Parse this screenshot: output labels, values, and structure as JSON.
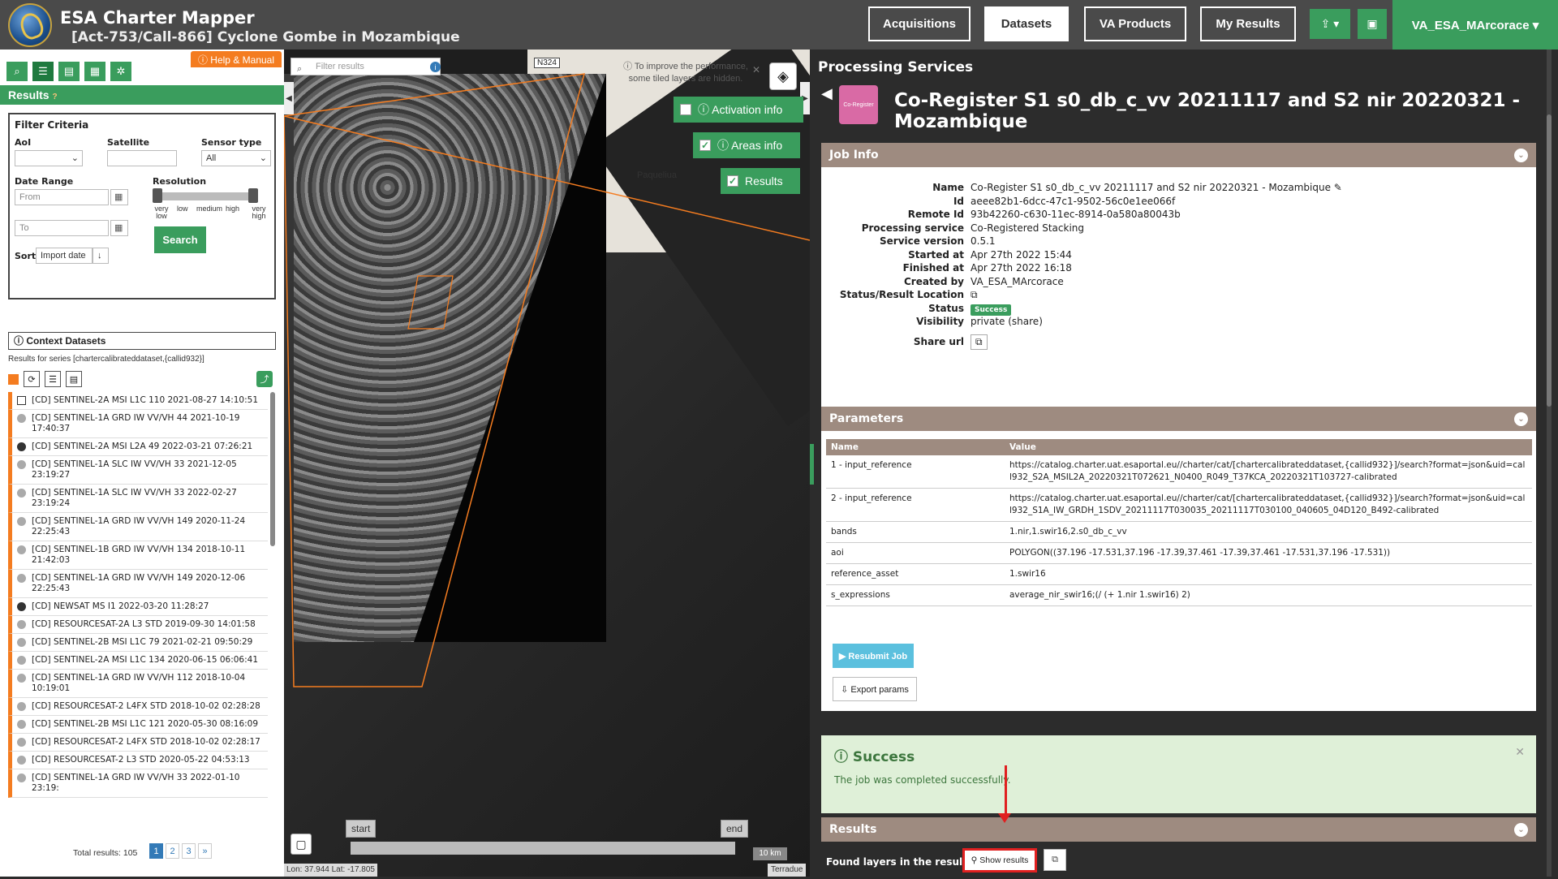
{
  "header": {
    "app_title": "ESA Charter Mapper",
    "activation": "[Act-753/Call-866] Cyclone Gombe in Mozambique",
    "nav": [
      "Acquisitions",
      "Datasets",
      "VA Products",
      "My Results"
    ],
    "active_nav": "Datasets",
    "user": "VA_ESA_MArcorace ▾",
    "upload_icon": "upload-icon",
    "briefcase_icon": "briefcase-icon"
  },
  "left": {
    "help": "ⓘ Help & Manual",
    "results_title": "Results",
    "filter": {
      "title": "Filter Criteria",
      "aoi_label": "AoI",
      "satellite_label": "Satellite",
      "sensor_label": "Sensor type",
      "sensor_value": "All",
      "date_label": "Date Range",
      "from_placeholder": "From",
      "to_placeholder": "To",
      "resolution_label": "Resolution",
      "res_ticks": [
        "very low",
        "low",
        "medium",
        "high",
        "very high"
      ],
      "sort_label": "Sort",
      "sort_value": "Import date",
      "search": "Search"
    },
    "context_title": "Context Datasets",
    "series_label": "Results for series [chartercalibrateddataset,{callid932}]",
    "datasets": [
      "[CD] SENTINEL-2A MSI L1C 110 2021-08-27 14:10:51",
      "[CD] SENTINEL-1A GRD IW VV/VH 44 2021-10-19 17:40:37",
      "[CD] SENTINEL-2A MSI L2A 49 2022-03-21 07:26:21",
      "[CD] SENTINEL-1A SLC IW VV/VH 33 2021-12-05 23:19:27",
      "[CD] SENTINEL-1A SLC IW VV/VH 33 2022-02-27 23:19:24",
      "[CD] SENTINEL-1A GRD IW VV/VH 149 2020-11-24 22:25:43",
      "[CD] SENTINEL-1B GRD IW VV/VH 134 2018-10-11 21:42:03",
      "[CD] SENTINEL-1A GRD IW VV/VH 149 2020-12-06 22:25:43",
      "[CD] NEWSAT MS I1 2022-03-20 11:28:27",
      "[CD] RESOURCESAT-2A L3 STD 2019-09-30 14:01:58",
      "[CD] SENTINEL-2B MSI L1C 79 2021-02-21 09:50:29",
      "[CD] SENTINEL-2A MSI L1C 134 2020-06-15 06:06:41",
      "[CD] SENTINEL-1A GRD IW VV/VH 112 2018-10-04 10:19:01",
      "[CD] RESOURCESAT-2 L4FX STD 2018-10-02 02:28:28",
      "[CD] SENTINEL-2B MSI L1C 121 2020-05-30 08:16:09",
      "[CD] RESOURCESAT-2 L4FX STD 2018-10-02 02:28:17",
      "[CD] RESOURCESAT-2 L3 STD 2020-05-22 04:53:13",
      "[CD] SENTINEL-1A GRD IW VV/VH 33 2022-01-10 23:19:"
    ],
    "total_results": "Total results: 105",
    "pages": [
      "1",
      "2",
      "3",
      "»"
    ]
  },
  "map": {
    "filter_placeholder": "Filter results",
    "perf_note": "ⓘ To improve the performance, some tiled layers are hidden.",
    "activation_info": "ⓘ Activation info",
    "areas_info": "ⓘ Areas info",
    "results_btn": "Results",
    "road": "N324",
    "place": "Paqueliua",
    "timeline_start": "start",
    "timeline_end": "end",
    "scale": "10 km",
    "coords": "Lon: 37.944 Lat: -17.805",
    "attribution": "Terradue"
  },
  "right": {
    "section_title": "Processing Services",
    "job_title": "Co-Register S1 s0_db_c_vv 20211117 and S2 nir 20220321 - Mozambique",
    "svc_icon_label": "Co-Register",
    "job_info_title": "Job Info",
    "job_info": [
      {
        "k": "Name",
        "v": "Co-Register S1 s0_db_c_vv 20211117 and S2 nir 20220321 - Mozambique ✎"
      },
      {
        "k": "Id",
        "v": "aeee82b1-6dcc-47c1-9502-56c0e1ee066f"
      },
      {
        "k": "Remote Id",
        "v": "93b42260-c630-11ec-8914-0a580a80043b"
      },
      {
        "k": "Processing service",
        "v": "Co-Registered Stacking"
      },
      {
        "k": "Service version",
        "v": "0.5.1"
      },
      {
        "k": "Started at",
        "v": "Apr 27th 2022 15:44"
      },
      {
        "k": "Finished at",
        "v": "Apr 27th 2022 16:18"
      },
      {
        "k": "Created by",
        "v": "VA_ESA_MArcorace"
      },
      {
        "k": "Status/Result Location",
        "v": "⧉"
      },
      {
        "k": "Status",
        "v": "Success"
      },
      {
        "k": "Visibility",
        "v": "private (share)"
      },
      {
        "k": "Share url",
        "v": "⧉"
      }
    ],
    "params_title": "Parameters",
    "params_headers": [
      "Name",
      "Value"
    ],
    "params": [
      {
        "name": "1 - input_reference",
        "value": "https://catalog.charter.uat.esaportal.eu//charter/cat/[chartercalibrateddataset,{callid932}]/search?format=json&uid=call932_S2A_MSIL2A_20220321T072621_N0400_R049_T37KCA_20220321T103727-calibrated"
      },
      {
        "name": "2 - input_reference",
        "value": "https://catalog.charter.uat.esaportal.eu//charter/cat/[chartercalibrateddataset,{callid932}]/search?format=json&uid=call932_S1A_IW_GRDH_1SDV_20211117T030035_20211117T030100_040605_04D120_B492-calibrated"
      },
      {
        "name": "bands",
        "value": "1.nir,1.swir16,2.s0_db_c_vv"
      },
      {
        "name": "aoi",
        "value": "POLYGON((37.196 -17.531,37.196 -17.39,37.461 -17.39,37.461 -17.531,37.196 -17.531))"
      },
      {
        "name": "reference_asset",
        "value": "1.swir16"
      },
      {
        "name": "s_expressions",
        "value": "average_nir_swir16;(/ (+ 1.nir 1.swir16) 2)"
      }
    ],
    "resubmit": "▶ Resubmit Job",
    "export": "⇩ Export params",
    "success_title": "ⓘ Success",
    "success_msg": "The job was completed successfully.",
    "results_title": "Results",
    "found_label": "Found layers in the result.",
    "show_results": "⚲ Show results",
    "copy_icon": "⧉"
  }
}
